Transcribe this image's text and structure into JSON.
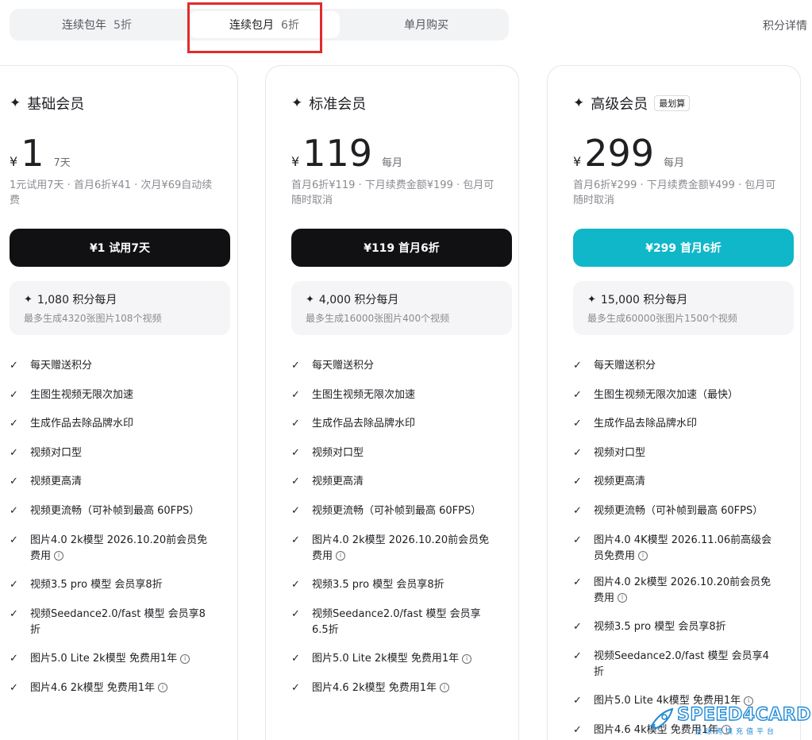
{
  "tabs": [
    {
      "label": "连续包年",
      "discount": "5折"
    },
    {
      "label": "连续包月",
      "discount": "6折"
    },
    {
      "label": "单月购买",
      "discount": ""
    }
  ],
  "points_detail": "积分详情",
  "plans": {
    "basic": {
      "name": "基础会员",
      "badge": "",
      "currency": "¥",
      "price": "1",
      "period": "7天",
      "desc": "1元试用7天 · 首月6折¥41 · 次月¥69自动续费",
      "cta": "¥1 试用7天",
      "credits": "1,080 积分每月",
      "credits_sub": "最多生成4320张图片108个视频",
      "features": [
        "每天赠送积分",
        "生图生视频无限次加速",
        "生成作品去除品牌水印",
        "视频对口型",
        "视频更高清",
        "视频更流畅（可补帧到最高 60FPS）",
        "图片4.0 2k模型 2026.10.20前会员免费用",
        "视频3.5 pro 模型 会员享8折",
        "视频Seedance2.0/fast 模型 会员享8折",
        "图片5.0 Lite 2k模型 免费用1年",
        "图片4.6 2k模型 免费用1年"
      ]
    },
    "standard": {
      "name": "标准会员",
      "badge": "",
      "currency": "¥",
      "price": "119",
      "period": "每月",
      "desc": "首月6折¥119 · 下月续费金额¥199 · 包月可随时取消",
      "cta": "¥119 首月6折",
      "credits": "4,000 积分每月",
      "credits_sub": "最多生成16000张图片400个视频",
      "features": [
        "每天赠送积分",
        "生图生视频无限次加速",
        "生成作品去除品牌水印",
        "视频对口型",
        "视频更高清",
        "视频更流畅（可补帧到最高 60FPS）",
        "图片4.0 2k模型 2026.10.20前会员免费用",
        "视频3.5 pro 模型 会员享8折",
        "视频Seedance2.0/fast 模型 会员享6.5折",
        "图片5.0 Lite 2k模型 免费用1年",
        "图片4.6 2k模型 免费用1年"
      ]
    },
    "premium": {
      "name": "高级会员",
      "badge": "最划算",
      "currency": "¥",
      "price": "299",
      "period": "每月",
      "desc": "首月6折¥299 · 下月续费金额¥499 · 包月可随时取消",
      "cta": "¥299 首月6折",
      "credits": "15,000 积分每月",
      "credits_sub": "最多生成60000张图片1500个视频",
      "features": [
        "每天赠送积分",
        "生图生视频无限次加速（最快）",
        "生成作品去除品牌水印",
        "视频对口型",
        "视频更高清",
        "视频更流畅（可补帧到最高 60FPS）",
        "图片4.0 4K模型 2026.11.06前高级会员免费用",
        "图片4.0 2k模型 2026.10.20前会员免费用",
        "视频3.5 pro 模型 会员享8折",
        "视频Seedance2.0/fast 模型 会员享4折",
        "图片5.0 Lite 4k模型 免费用1年",
        "图片4.6 4k模型 免费用1年"
      ]
    }
  },
  "watermark": {
    "name": "SPEED4CARD",
    "tagline": "全球跨境充值平台"
  },
  "colors": {
    "accent_teal": "#10b7c8",
    "cta_dark": "#111114",
    "highlight_red": "#e02b2b",
    "brand_blue": "#1f8ad6"
  }
}
